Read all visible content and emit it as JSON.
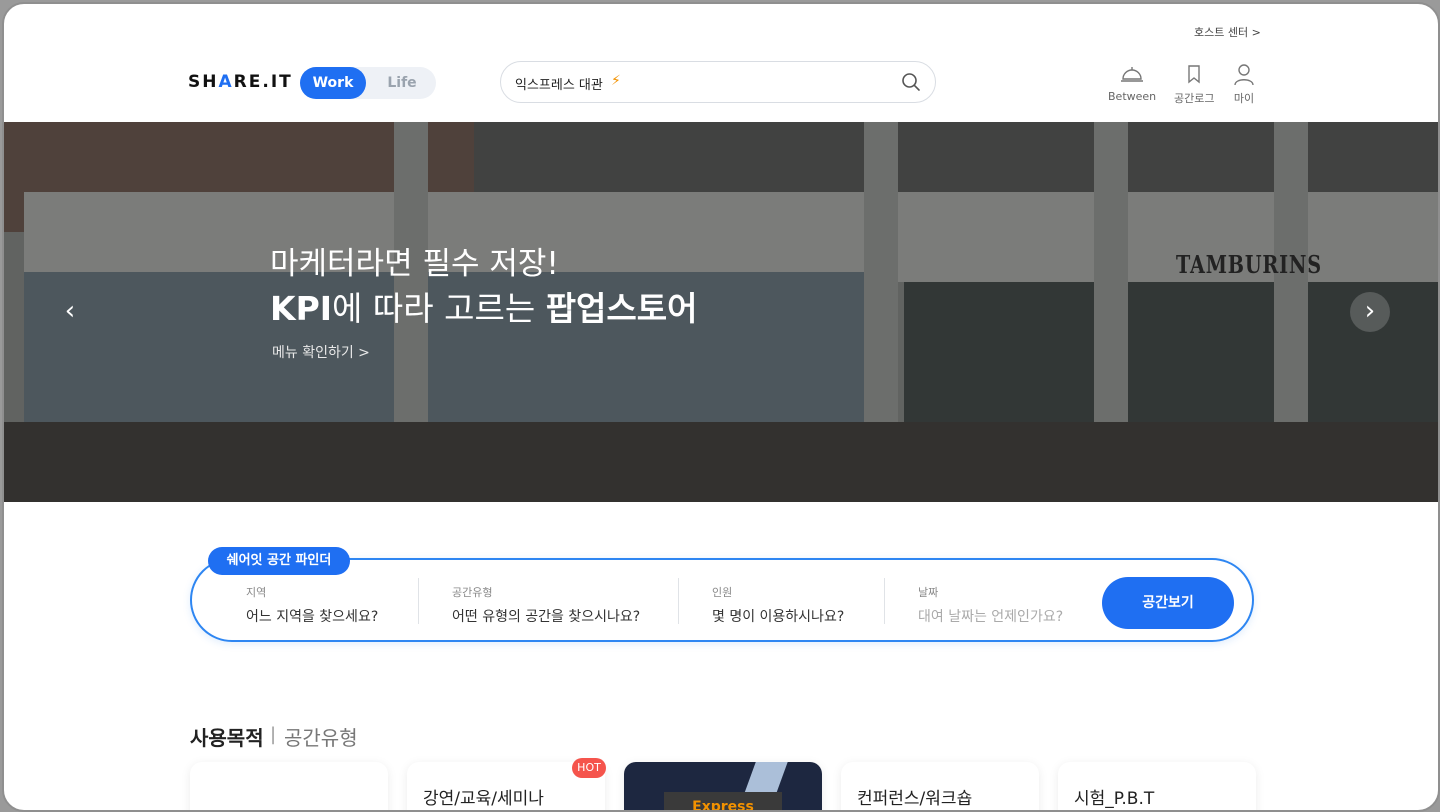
{
  "header": {
    "host_center": "호스트 센터 >",
    "logo_prefix": "SH",
    "logo_accent": "A",
    "logo_suffix": "RE.IT",
    "mode_work": "Work",
    "mode_life": "Life",
    "search_text": "익스프레스 대관",
    "actions": [
      {
        "label": "Between",
        "icon": "service-bell-icon"
      },
      {
        "label": "공간로그",
        "icon": "bookmark-icon"
      },
      {
        "label": "마이",
        "icon": "user-icon"
      }
    ]
  },
  "hero": {
    "title_line1": "마케터라면 필수 저장!",
    "title_line2_bold": "KPI",
    "title_line2_mid": "에 따라 고르는 ",
    "title_line2_bold2": "팝업스토어",
    "link": "메뉴 확인하기 >",
    "sign": "TAMBURINS"
  },
  "finder": {
    "badge": "쉐어잇 공간 파인더",
    "fields": [
      {
        "label": "지역",
        "value": "어느 지역을 찾으세요?"
      },
      {
        "label": "공간유형",
        "value": "어떤 유형의 공간을 찾으시나요?"
      },
      {
        "label": "인원",
        "value": "몇 명이 이용하시나요?"
      },
      {
        "label": "날짜",
        "value": "대여 날짜는 언제인가요?"
      }
    ],
    "button": "공간보기"
  },
  "tabs": {
    "purpose": "사용목적",
    "separator": "|",
    "type": "공간유형"
  },
  "cards": [
    {
      "title": ""
    },
    {
      "title": "강연/교육/세미나",
      "badge": "HOT"
    },
    {
      "title": "",
      "image_text": "Express"
    },
    {
      "title": "컨퍼런스/워크숍"
    },
    {
      "title": "시험_P.B.T"
    }
  ],
  "colors": {
    "accent": "#1f6ff2",
    "hot": "#f5544c",
    "bolt": "#f39200"
  }
}
